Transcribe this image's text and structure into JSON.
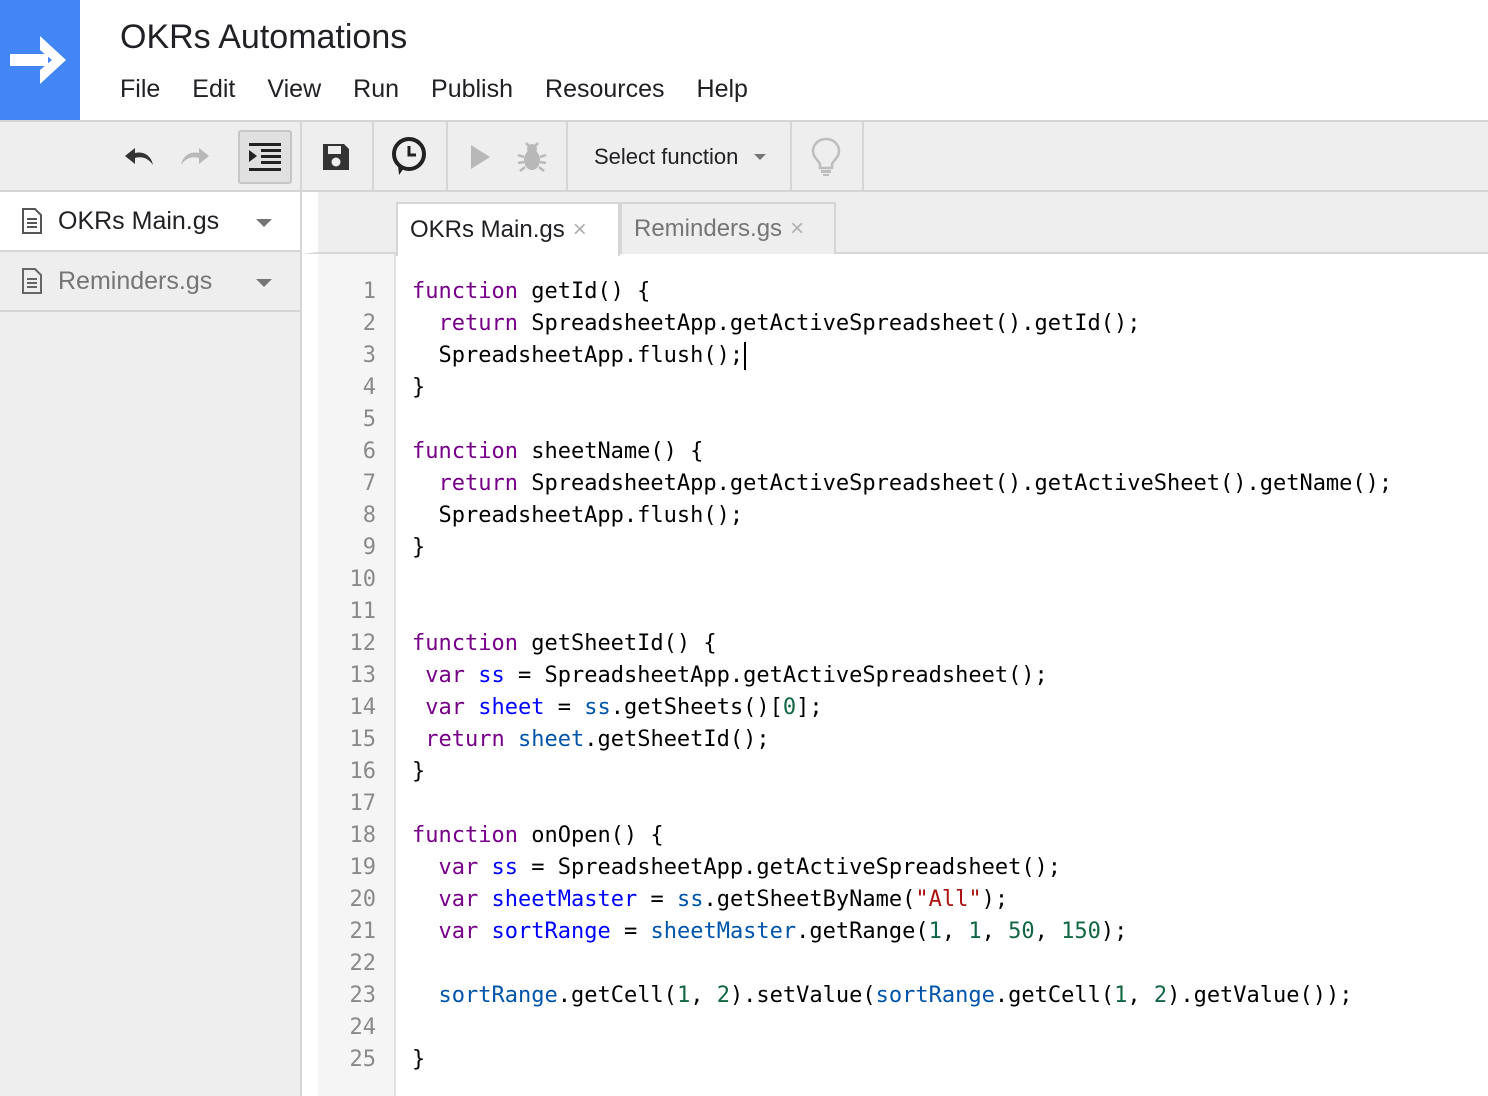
{
  "app": {
    "title": "OKRs Automations",
    "accent_color": "#4285f4",
    "logo_icon": "arrow-right-icon"
  },
  "menu": [
    "File",
    "Edit",
    "View",
    "Run",
    "Publish",
    "Resources",
    "Help"
  ],
  "toolbar": {
    "undo_icon": "undo-icon",
    "redo_icon": "redo-icon",
    "indent_icon": "indent-icon",
    "save_icon": "save-icon",
    "triggers_icon": "clock-trigger-icon",
    "run_icon": "play-icon",
    "debug_icon": "bug-icon",
    "select_function_label": "Select function",
    "lightbulb_icon": "lightbulb-icon"
  },
  "sidebar": {
    "files": [
      {
        "name": "OKRs Main.gs",
        "active": true
      },
      {
        "name": "Reminders.gs",
        "active": false
      }
    ]
  },
  "tabs": [
    {
      "label": "OKRs Main.gs",
      "close": "×",
      "active": true
    },
    {
      "label": "Reminders.gs",
      "close": "×",
      "active": false
    }
  ],
  "code_lines": [
    "function getId() {",
    "  return SpreadsheetApp.getActiveSpreadsheet().getId();",
    "  SpreadsheetApp.flush();",
    "}",
    "",
    "function sheetName() {",
    "  return SpreadsheetApp.getActiveSpreadsheet().getActiveSheet().getName();",
    "  SpreadsheetApp.flush();",
    "}",
    "",
    "",
    "function getSheetId() {",
    " var ss = SpreadsheetApp.getActiveSpreadsheet();",
    " var sheet = ss.getSheets()[0];",
    " return sheet.getSheetId();",
    "}",
    "",
    "function onOpen() {",
    "  var ss = SpreadsheetApp.getActiveSpreadsheet();",
    "  var sheetMaster = ss.getSheetByName(\"All\");",
    "  var sortRange = sheetMaster.getRange(1, 1, 50, 150);",
    "",
    "  sortRange.getCell(1, 2).setValue(sortRange.getCell(1, 2).getValue());",
    "",
    "}"
  ],
  "cursor_line": 3
}
